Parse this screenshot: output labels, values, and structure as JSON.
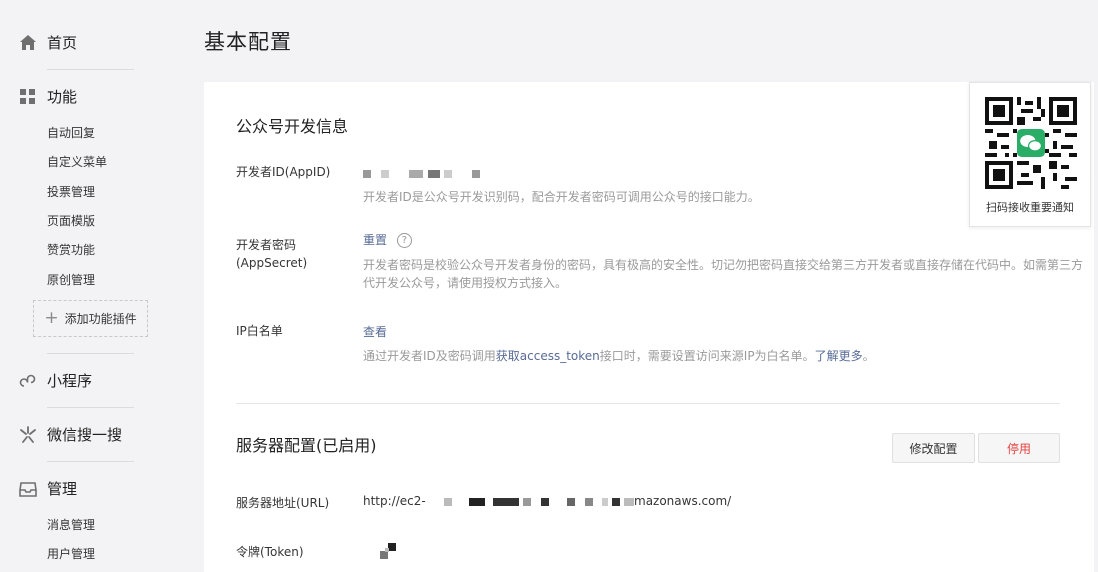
{
  "sidebar": {
    "home": "首页",
    "features": "功能",
    "feature_items": [
      "自动回复",
      "自定义菜单",
      "投票管理",
      "页面模版",
      "赞赏功能",
      "原创管理"
    ],
    "add_plugin": "添加功能插件",
    "mini_program": "小程序",
    "wechat_search": "微信搜一搜",
    "manage": "管理",
    "manage_items": [
      "消息管理",
      "用户管理"
    ]
  },
  "page": {
    "title": "基本配置"
  },
  "dev_info": {
    "title": "公众号开发信息",
    "appid_label": "开发者ID(AppID)",
    "appid_desc": "开发者ID是公众号开发识别码，配合开发者密码可调用公众号的接口能力。",
    "secret_label_1": "开发者密码",
    "secret_label_2": "(AppSecret)",
    "secret_reset": "重置",
    "secret_help": "?",
    "secret_desc_1": "开发者密码是校验公众号开发者身份的密码，具有极高的安全性。切记勿把密码直接交给第三方开发者或直接存储在代码中。如需第三方",
    "secret_desc_2": "代开发公众号，请使用授权方式接入。",
    "ip_label": "IP白名单",
    "ip_view": "查看",
    "ip_desc_prefix": "通过开发者ID及密码调用",
    "ip_desc_link": "获取access_token",
    "ip_desc_mid": "接口时，需要设置访问来源IP为白名单。",
    "ip_desc_more": "了解更多",
    "ip_desc_end": "。"
  },
  "server": {
    "title": "服务器配置(已启用)",
    "edit_btn": "修改配置",
    "stop_btn": "停用",
    "url_label": "服务器地址(URL)",
    "url_prefix": "http://ec2-",
    "url_suffix": "mazonaws.com/",
    "token_label": "令牌(Token)"
  },
  "qr": {
    "caption": "扫码接收重要通知"
  }
}
